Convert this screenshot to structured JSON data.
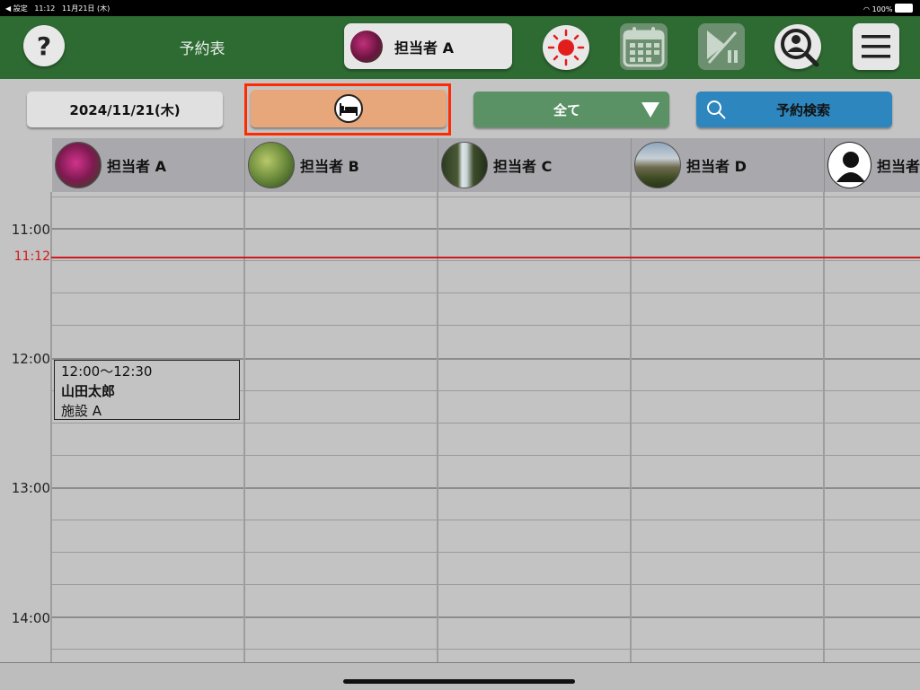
{
  "status_bar": {
    "back_label": "◀ 設定",
    "time": "11:12",
    "date": "11月21日 (木)",
    "battery": "100%"
  },
  "header": {
    "help_label": "?",
    "title": "予約表",
    "staff_selector_label": "担当者 A"
  },
  "toolbar": {
    "date_label": "2024/11/21(木)",
    "filter_label": "全て",
    "search_label": "予約検索"
  },
  "schedule": {
    "columns": [
      {
        "name": "担当者 A"
      },
      {
        "name": "担当者 B"
      },
      {
        "name": "担当者 C"
      },
      {
        "name": "担当者 D"
      },
      {
        "name": "担当者"
      }
    ],
    "time_labels": [
      "11:00",
      "12:00",
      "13:00",
      "14:00"
    ],
    "current_time": "11:12",
    "appointment": {
      "time": "12:00～12:30",
      "name": "山田太郎",
      "facility": "施設 A"
    }
  },
  "colors": {
    "header_green": "#2e6b33",
    "bed_button": "#e8a77a",
    "highlight": "#ff2a00",
    "filter_green": "#5a9165",
    "search_blue": "#2d86bd",
    "now_line": "#d0191b"
  }
}
